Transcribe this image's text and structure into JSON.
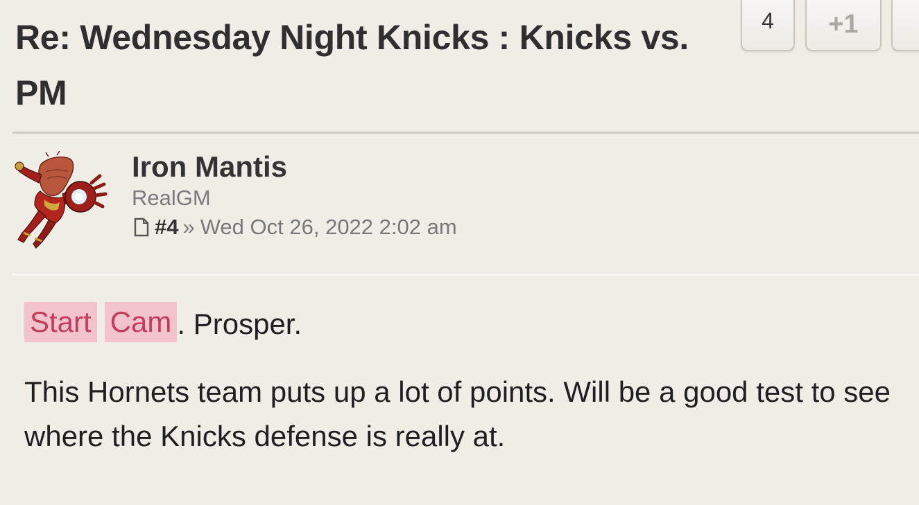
{
  "topic": {
    "title": "Re: Wednesday Night Knicks : Knicks vs. PM"
  },
  "actions": {
    "vote_count": "4",
    "plus_one_label": "+1"
  },
  "post": {
    "author": "Iron Mantis",
    "rank": "RealGM",
    "number": "#4",
    "separator": "»",
    "datetime": "Wed Oct 26, 2022 2:02 am",
    "icons": {
      "avatar": "iron-man-mantis-avatar",
      "post_link": "document-icon"
    },
    "body": {
      "line1": {
        "tag1": "Start",
        "tag2": "Cam",
        "rest": ". Prosper."
      },
      "line2": "This Hornets team puts up a lot of points. Will be a good test to see where the Knicks defense is really at."
    }
  },
  "colors": {
    "page_background": "#efede6",
    "highlight_background": "#f2c2cd",
    "highlight_text": "#c23d5b"
  }
}
